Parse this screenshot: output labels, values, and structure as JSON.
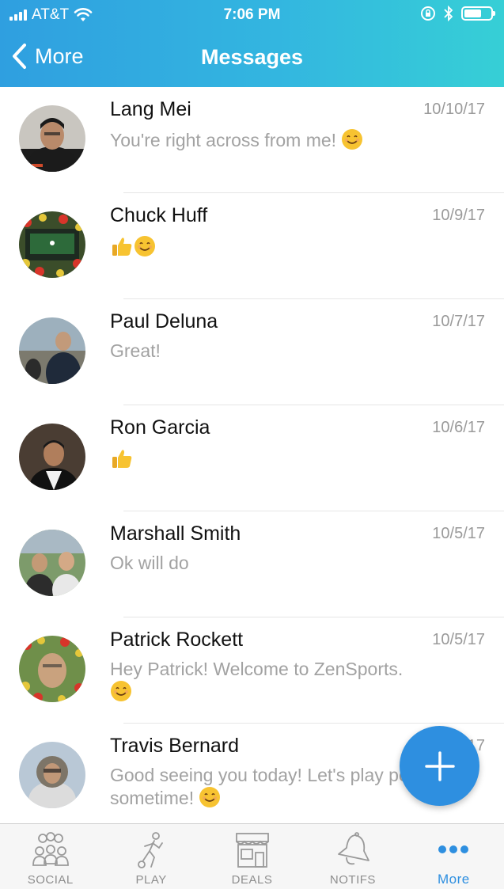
{
  "status_bar": {
    "carrier": "AT&T",
    "time": "7:06 PM"
  },
  "nav": {
    "back_label": "More",
    "title": "Messages"
  },
  "conversations": [
    {
      "name": "Lang Mei",
      "date": "10/10/17",
      "preview": "You're right across from me!",
      "emoji": [
        "smile"
      ]
    },
    {
      "name": "Chuck Huff",
      "date": "10/9/17",
      "preview": "",
      "emoji": [
        "thumbs-up",
        "smile"
      ]
    },
    {
      "name": "Paul Deluna",
      "date": "10/7/17",
      "preview": "Great!",
      "emoji": []
    },
    {
      "name": "Ron Garcia",
      "date": "10/6/17",
      "preview": "",
      "emoji": [
        "thumbs-up"
      ]
    },
    {
      "name": "Marshall Smith",
      "date": "10/5/17",
      "preview": "Ok will do",
      "emoji": []
    },
    {
      "name": "Patrick Rockett",
      "date": "10/5/17",
      "preview": "Hey Patrick! Welcome to ZenSports.",
      "emoji": [
        "smile"
      ]
    },
    {
      "name": "Travis Bernard",
      "date": "10/4/17",
      "preview": "Good seeing you today! Let's play pool sometime!",
      "emoji": [
        "smile"
      ]
    }
  ],
  "tabs": [
    {
      "label": "SOCIAL",
      "icon": "people-icon"
    },
    {
      "label": "PLAY",
      "icon": "player-icon"
    },
    {
      "label": "DEALS",
      "icon": "storefront-icon"
    },
    {
      "label": "NOTIFS",
      "icon": "bell-icon"
    },
    {
      "label": "More",
      "icon": "more-dots-icon"
    }
  ],
  "colors": {
    "accent": "#2e8fe0",
    "header_start": "#2f9fe0",
    "header_end": "#36cfd6"
  }
}
